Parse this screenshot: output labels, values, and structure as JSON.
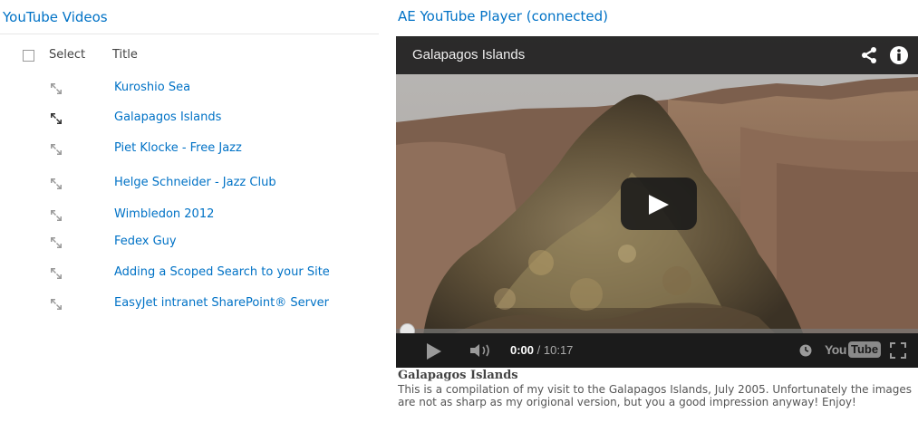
{
  "list_part": {
    "title": "YouTube Videos",
    "header": {
      "select_label": "Select",
      "title_label": "Title"
    },
    "items": [
      {
        "title": "Kuroshio Sea",
        "selected": false
      },
      {
        "title": "Galapagos Islands",
        "selected": true
      },
      {
        "title": "Piet Klocke - Free Jazz",
        "selected": false
      },
      {
        "title": "Helge Schneider - Jazz Club",
        "selected": false
      },
      {
        "title": "Wimbledon 2012",
        "selected": false
      },
      {
        "title": "Fedex Guy",
        "selected": false
      },
      {
        "title": "Adding a Scoped Search to your Site",
        "selected": false
      },
      {
        "title": "EasyJet intranet SharePoint® Server",
        "selected": false
      }
    ],
    "row_icon": "connection-arrows-icon"
  },
  "player_part": {
    "title": "AE YouTube Player (connected)",
    "video_title": "Galapagos Islands",
    "icons": [
      "share-icon",
      "info-icon",
      "big-play-icon",
      "play-icon",
      "volume-icon",
      "clock-icon",
      "fullscreen-icon"
    ],
    "time_current": "0:00",
    "time_total": " / 10:17",
    "progress": 0.0,
    "logo_you": "You",
    "logo_tube": "Tube",
    "description_title": "Galapagos Islands",
    "description_text": "This is a compilation of my visit to the Galapagos Islands, July 2005. Unfortunately the images are not as sharp as my origional version, but you a good impression anyway! Enjoy!"
  },
  "colors": {
    "link": "#0072c6",
    "text": "#444444",
    "player_bg": "#1b1b1b"
  }
}
